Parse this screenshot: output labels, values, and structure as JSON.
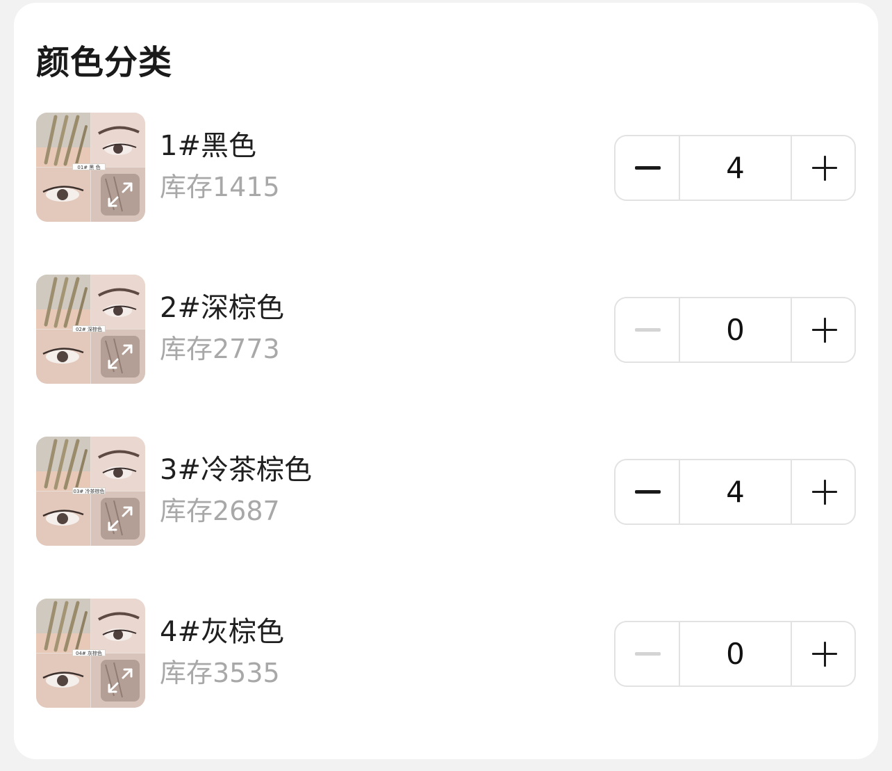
{
  "section": {
    "title": "颜色分类"
  },
  "items": [
    {
      "name": "1#黑色",
      "stock": "库存1415",
      "qty": "4",
      "caption": "01# 黑 色",
      "minus_enabled": true
    },
    {
      "name": "2#深棕色",
      "stock": "库存2773",
      "qty": "0",
      "caption": "02# 深棕色",
      "minus_enabled": false
    },
    {
      "name": "3#冷茶棕色",
      "stock": "库存2687",
      "qty": "4",
      "caption": "03# 冷茶棕色",
      "minus_enabled": true
    },
    {
      "name": "4#灰棕色",
      "stock": "库存3535",
      "qty": "0",
      "caption": "04# 灰棕色",
      "minus_enabled": false
    }
  ],
  "icons": {
    "minus": "minus-icon",
    "plus": "plus-icon",
    "expand": "expand-arrows-icon"
  },
  "colors": {
    "disabled_minus": "#d4d4d4",
    "stock_text": "#a8a8a8",
    "border": "#e2e2e2"
  }
}
